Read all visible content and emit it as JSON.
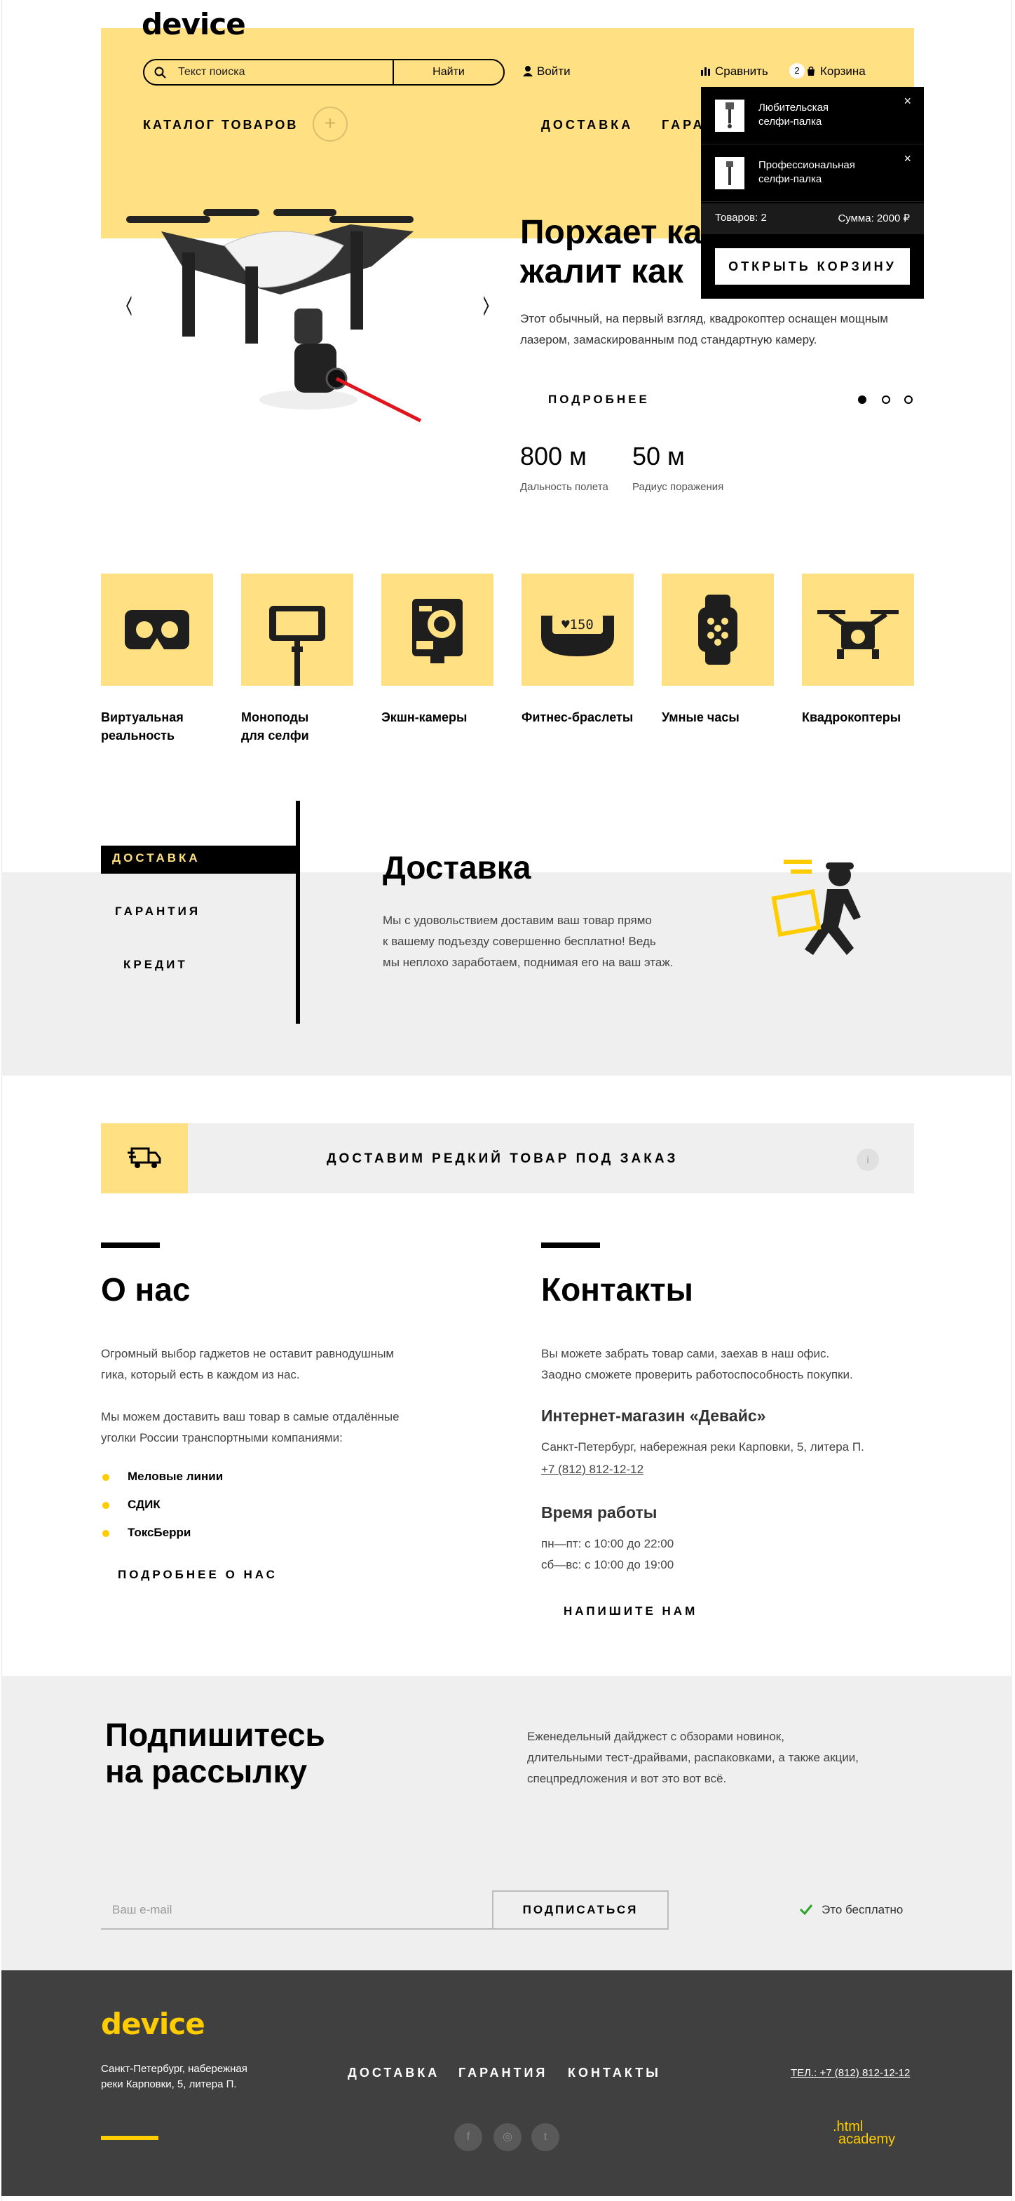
{
  "header": {
    "logo": "device",
    "search_placeholder": "Текст поиска",
    "search_button": "Найти",
    "login": "Войти",
    "compare": "Сравнить",
    "cart_count": "2",
    "cart": "Корзина",
    "catalog": "КАТАЛОГ ТОВАРОВ",
    "nav": [
      "ДОСТАВКА",
      "ГАРА"
    ]
  },
  "cart_popup": {
    "items": [
      {
        "name": "Любительская селфи-палка"
      },
      {
        "name": "Профессиональная селфи-палка"
      }
    ],
    "remove_icon": "×",
    "count_label": "Товаров: 2",
    "sum_label": "Сумма: 2000 ₽",
    "open_button": "ОТКРЫТЬ КОРЗИНУ"
  },
  "slider": {
    "title_line1": "Порхает ка",
    "title_line2": "жалит как",
    "text": "Этот обычный, на первый взгляд, квадрокоптер оснащен мощным лазером, замаскированным под стандартную камеру.",
    "more": "ПОДРОБНЕЕ",
    "prev": "‹",
    "next": "›",
    "active_slide": 1,
    "stats": [
      {
        "value": "800 м",
        "label": "Дальность полета"
      },
      {
        "value": "50 м",
        "label": "Радиус поражения"
      }
    ]
  },
  "categories": [
    {
      "label1": "Виртуальная",
      "label2": "реальность",
      "icon": "vr-headset-icon"
    },
    {
      "label1": "Моноподы",
      "label2": "для селфи",
      "icon": "selfie-stick-icon"
    },
    {
      "label1": "Экшн-камеры",
      "label2": "",
      "icon": "action-camera-icon"
    },
    {
      "label1": "Фитнес-браслеты",
      "label2": "",
      "icon": "fitness-band-icon"
    },
    {
      "label1": "Умные часы",
      "label2": "",
      "icon": "smartwatch-icon"
    },
    {
      "label1": "Квадрокоптеры",
      "label2": "",
      "icon": "drone-icon"
    }
  ],
  "services": {
    "tabs": [
      "ДОСТАВКА",
      "ГАРАНТИЯ",
      "КРЕДИТ"
    ],
    "title": "Доставка",
    "text_lines": [
      "Мы с удовольствием доставим ваш товар прямо",
      "к вашему подъезду совершенно бесплатно! Ведь",
      "мы неплохо заработаем, поднимая его на ваш этаж."
    ]
  },
  "promo": {
    "text": "ДОСТАВИМ РЕДКИЙ ТОВАР ПОД ЗАКАЗ",
    "info": "i"
  },
  "about": {
    "title": "О нас",
    "p1_lines": [
      "Огромный выбор гаджетов не оставит равнодушным",
      "гика, который есть в каждом из нас."
    ],
    "p2_lines": [
      "Мы можем доставить ваш товар в самые отдалённые",
      "уголки России транспортными компаниями:"
    ],
    "list": [
      "Меловые линии",
      "СДИК",
      "ТоксБерри"
    ],
    "more": "ПОДРОБНЕЕ О НАС"
  },
  "contacts": {
    "title": "Контакты",
    "p_lines": [
      "Вы можете забрать товар сами, заехав в наш офис.",
      "Заодно сможете проверить работоспособность покупки."
    ],
    "shop_title": "Интернет-магазин «Девайс»",
    "address": "Санкт-Петербург, набережная реки Карповки, 5, литера П.",
    "phone": "+7 (812) 812-12-12",
    "hours_title": "Время работы",
    "hours1": "пн—пт: с 10:00 до 22:00",
    "hours2": "сб—вс: с 10:00 до 19:00",
    "write": "НАПИШИТЕ НАМ"
  },
  "subscribe": {
    "title_line1": "Подпишитесь",
    "title_line2": "на рассылку",
    "text_lines": [
      "Еженедельный дайджест с обзорами новинок,",
      "длительными тест-драйвами, распаковками, а также акции,",
      "спецпредложения и вот это вот всё."
    ],
    "email_placeholder": "Ваш e-mail",
    "button": "ПОДПИСАТЬСЯ",
    "free": "Это бесплатно"
  },
  "footer": {
    "logo": "device",
    "address_line1": "Санкт-Петербург, набережная",
    "address_line2": "реки Карповки, 5, литера П.",
    "nav": [
      "ДОСТАВКА",
      "ГАРАНТИЯ",
      "КОНТАКТЫ"
    ],
    "phone": "ТЕЛ.: +7 (812) 812-12-12",
    "social": [
      "f",
      "◎",
      "t"
    ],
    "academy_line1": ".html",
    "academy_line2": "academy"
  },
  "colors": {
    "accent": "#ffe083",
    "brand_yellow": "#ffcc00",
    "dark": "#404040"
  }
}
